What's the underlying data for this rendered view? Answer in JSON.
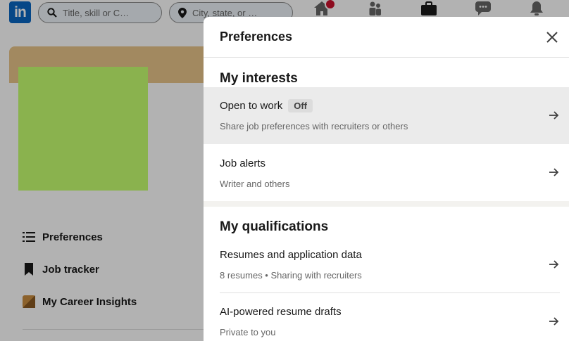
{
  "header": {
    "search_placeholder": "Title, skill or C…",
    "location_placeholder": "City, state, or …"
  },
  "sidebar": {
    "items": [
      {
        "label": "Preferences",
        "icon": "list-icon"
      },
      {
        "label": "Job tracker",
        "icon": "bookmark-icon"
      },
      {
        "label": "My Career Insights",
        "icon": "insights-icon"
      }
    ]
  },
  "panel": {
    "title": "Preferences",
    "sections": [
      {
        "title": "My interests",
        "items": [
          {
            "title": "Open to work",
            "badge": "Off",
            "subtitle": "Share job preferences with recruiters or others"
          },
          {
            "title": "Job alerts",
            "subtitle": "Writer and others"
          }
        ]
      },
      {
        "title": "My qualifications",
        "items": [
          {
            "title": "Resumes and application data",
            "subtitle": "8 resumes • Sharing with recruiters"
          },
          {
            "title": "AI-powered resume drafts",
            "subtitle": "Private to you"
          }
        ]
      }
    ]
  },
  "colors": {
    "brand": "#0a66c2",
    "avatar_placeholder": "#c6ff70",
    "banner": "#e8c58a",
    "highlight_row": "#ebebeb"
  }
}
